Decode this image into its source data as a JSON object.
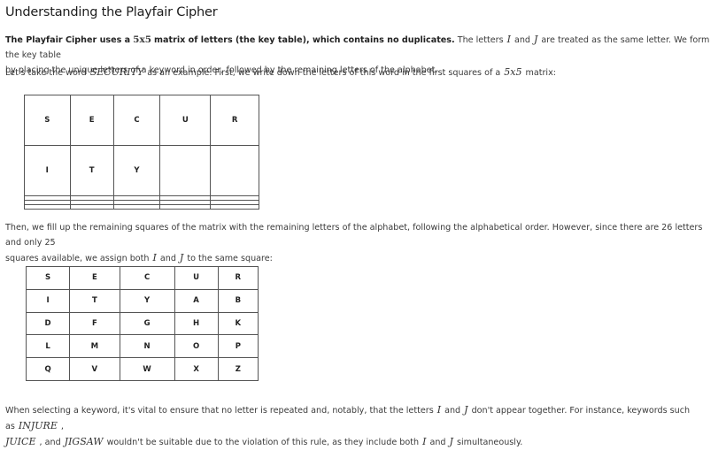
{
  "title": "Understanding the Playfair Cipher",
  "intro": {
    "bold_pre": "The Playfair Cipher uses a",
    "bold_math": "5x5",
    "bold_post": "matrix of letters (the key table), which contains no duplicates.",
    "text1": "The letters",
    "var_i": "I",
    "and": "and",
    "var_j": "J",
    "text2": "are treated as the same letter. We form the key table",
    "line2": "by placing the unique letters of a keyword in order, followed by the remaining letters of the alphabet."
  },
  "example": {
    "pre": "Let's take the word",
    "word": "SECURITY",
    "mid": "as an example. First, we write down the letters of this word in the first squares of a",
    "size": "5x5",
    "post": "matrix:"
  },
  "table1": [
    [
      "S",
      "E",
      "C",
      "U",
      "R"
    ],
    [
      "I",
      "T",
      "Y",
      "",
      ""
    ],
    [
      "",
      "",
      "",
      "",
      ""
    ],
    [
      "",
      "",
      "",
      "",
      ""
    ],
    [
      "",
      "",
      "",
      "",
      ""
    ]
  ],
  "then": {
    "line1": "Then, we fill up the remaining squares of the matrix with the remaining letters of the alphabet, following the alphabetical order. However, since there are 26 letters and only 25",
    "line2_pre": "squares available, we assign both",
    "var_i": "I",
    "and": "and",
    "var_j": "J",
    "line2_post": "to the same square:"
  },
  "table2": [
    [
      "S",
      "E",
      "C",
      "U",
      "R"
    ],
    [
      "I",
      "T",
      "Y",
      "A",
      "B"
    ],
    [
      "D",
      "F",
      "G",
      "H",
      "K"
    ],
    [
      "L",
      "M",
      "N",
      "O",
      "P"
    ],
    [
      "Q",
      "V",
      "W",
      "X",
      "Z"
    ]
  ],
  "closing": {
    "pre": "When selecting a keyword, it's vital to ensure that no letter is repeated and, notably, that the letters",
    "var_i": "I",
    "and": "and",
    "var_j": "J",
    "mid": "don't appear together. For instance, keywords such as",
    "kw1": "INJURE",
    "comma": ",",
    "kw2": "JUICE",
    "comma2": ",",
    "and2": "and",
    "kw3": "JIGSAW",
    "post": "wouldn't be suitable due to the violation of this rule, as they include both",
    "var_i2": "I",
    "and3": "and",
    "var_j2": "J",
    "end": "simultaneously."
  }
}
